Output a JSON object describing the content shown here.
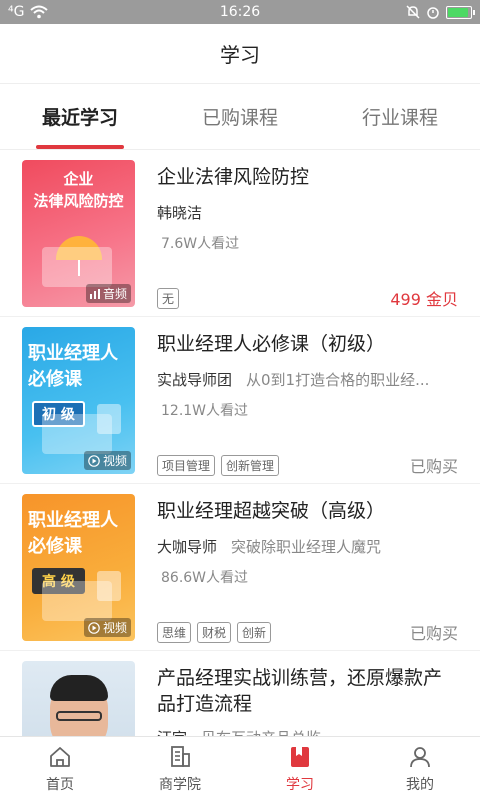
{
  "status_bar": {
    "time": "16:26",
    "left_text": "⁴G"
  },
  "header": {
    "title": "学习"
  },
  "tabs": [
    {
      "label": "最近学习",
      "active": true
    },
    {
      "label": "已购课程",
      "active": false
    },
    {
      "label": "行业课程",
      "active": false
    }
  ],
  "courses": [
    {
      "title": "企业法律风险防控",
      "author": "韩晓洁",
      "desc": "",
      "views": "7.6W人看过",
      "tags": [
        "无"
      ],
      "right_text": "499 金贝",
      "thumb": {
        "title_lines": [
          "企业",
          "法律风险防控"
        ],
        "badge": "音频"
      }
    },
    {
      "title": "职业经理人必修课（初级）",
      "author": "实战导师团",
      "desc": "从0到1打造合格的职业经...",
      "views": "12.1W人看过",
      "tags": [
        "项目管理",
        "创新管理"
      ],
      "right_text": "已购买",
      "thumb": {
        "title_lines": [
          "职业经理人",
          "必修课"
        ],
        "chip": "初 级",
        "badge": "视频"
      }
    },
    {
      "title": "职业经理超越突破（高级）",
      "author": "大咖导师",
      "desc": "突破除职业经理人魔咒",
      "views": "86.6W人看过",
      "tags": [
        "思维",
        "财税",
        "创新"
      ],
      "right_text": "已购买",
      "thumb": {
        "title_lines": [
          "职业经理人",
          "必修课"
        ],
        "chip": "高 级",
        "badge": "视频"
      }
    },
    {
      "title": "产品经理实战训练营，还原爆款产品打造流程",
      "author": "汪宇",
      "desc": "贝布互动产品总监",
      "views": "",
      "tags": [],
      "right_text": "",
      "thumb": {}
    }
  ],
  "nav": [
    {
      "label": "首页",
      "icon": "home-icon",
      "active": false
    },
    {
      "label": "商学院",
      "icon": "building-icon",
      "active": false
    },
    {
      "label": "学习",
      "icon": "book-icon",
      "active": true
    },
    {
      "label": "我的",
      "icon": "user-icon",
      "active": false
    }
  ],
  "colors": {
    "accent": "#e0383e",
    "status_bar": "#9b9b9b"
  }
}
